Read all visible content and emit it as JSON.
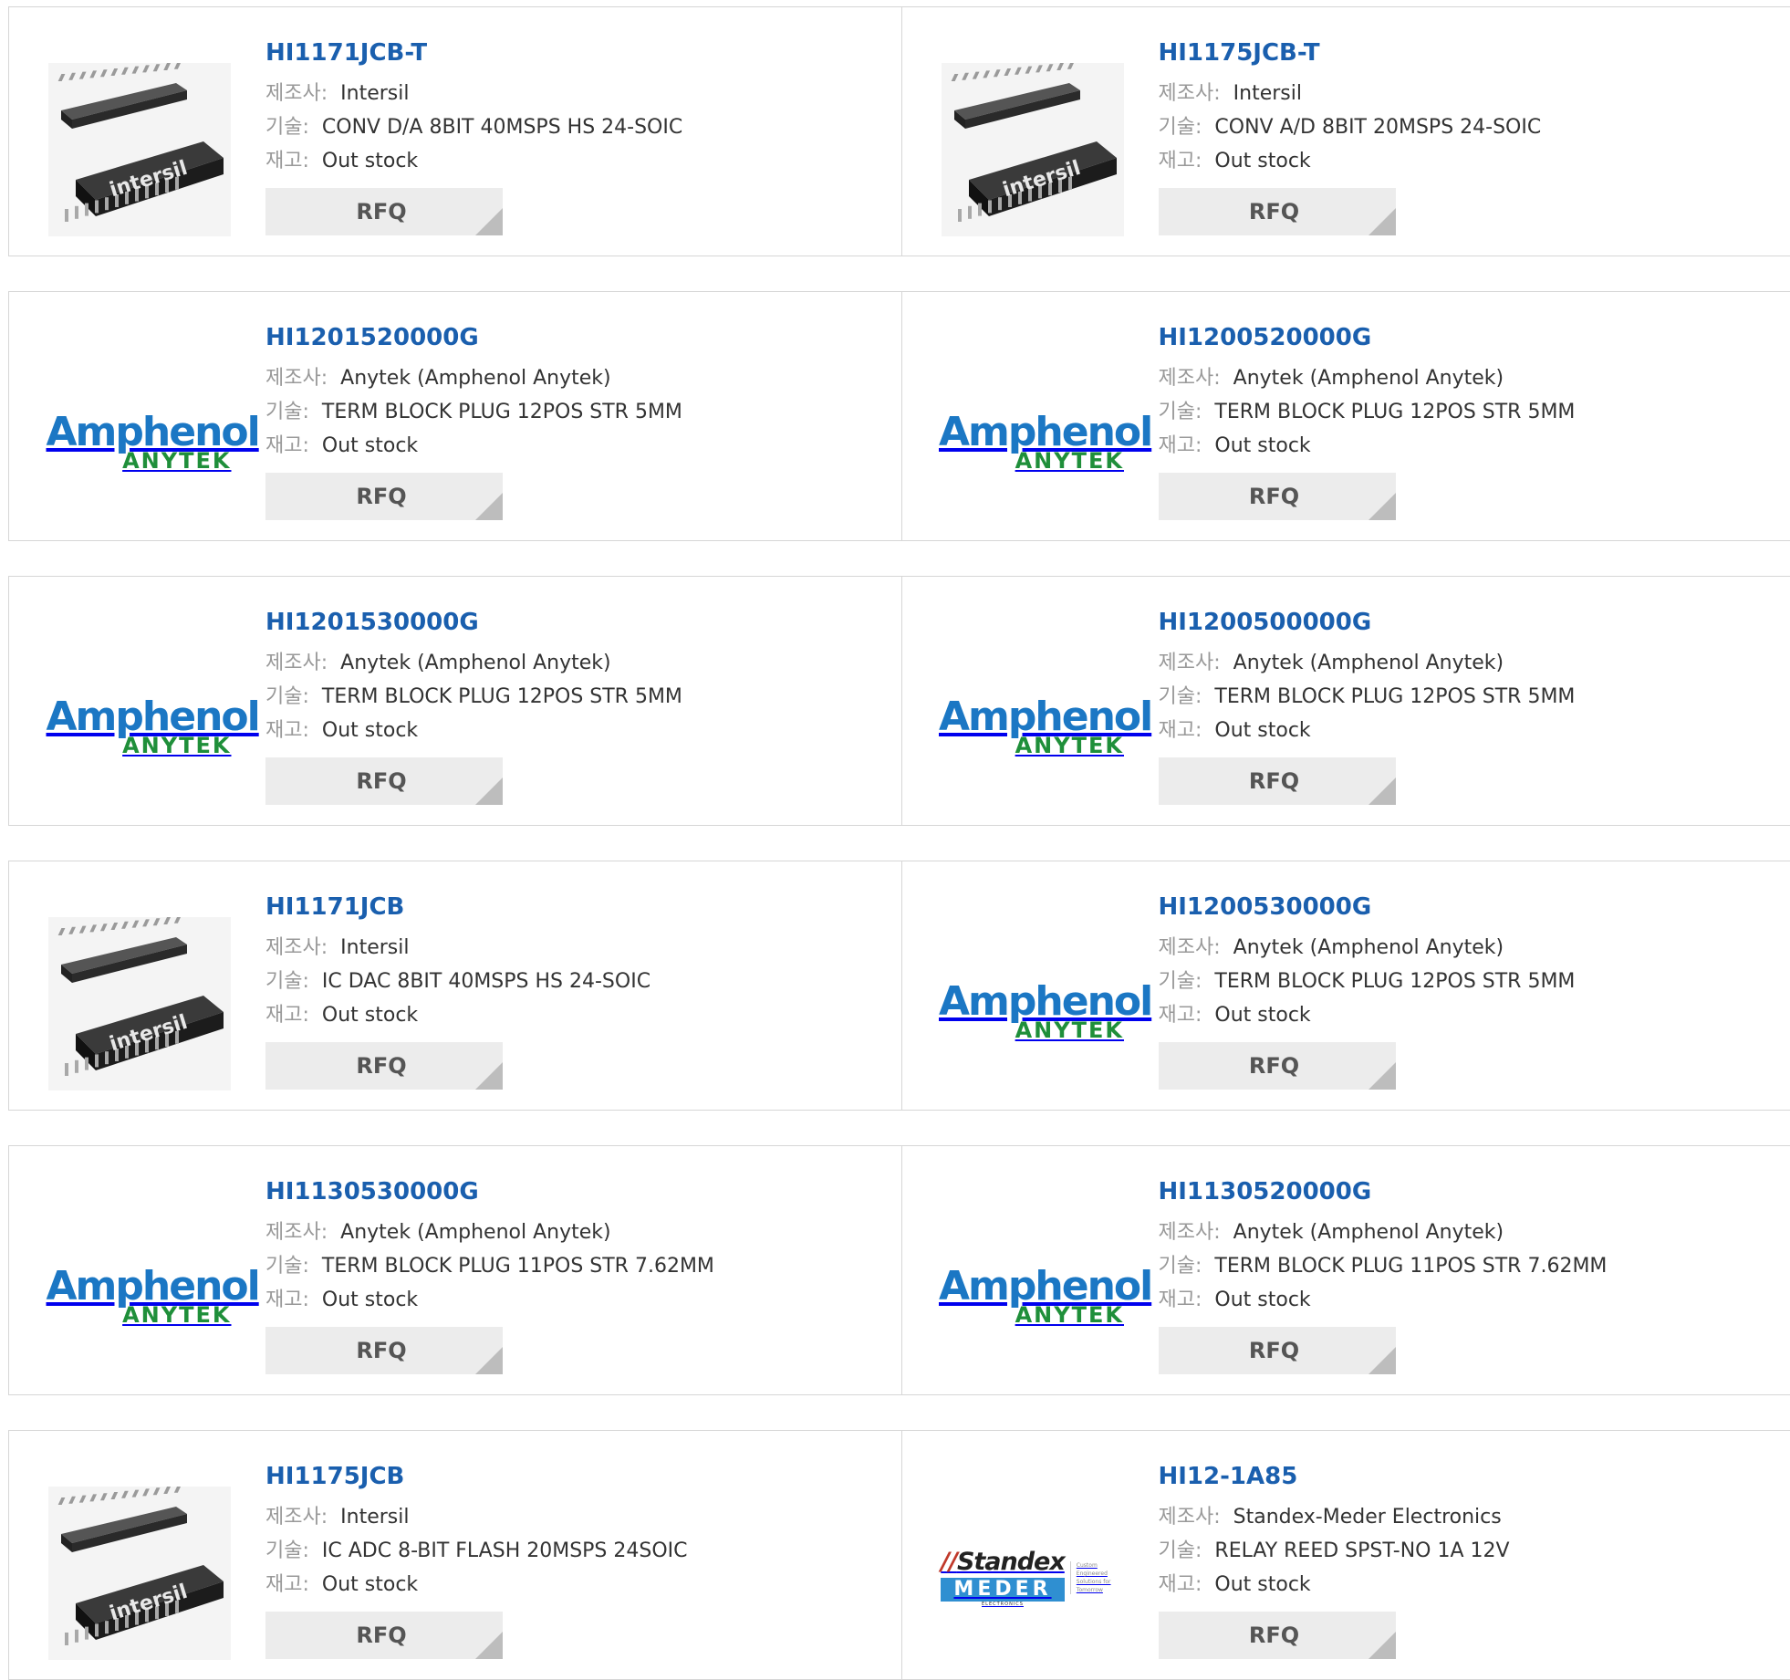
{
  "labels": {
    "manufacturer": "제조사",
    "description": "기술",
    "stock": "재고",
    "separator": ":",
    "rfq": "RFQ"
  },
  "logos": {
    "intersil_chip": "intersil",
    "amphenol_top": "Amphenol",
    "amphenol_bottom": "ANYTEK",
    "standex_top": "Standex",
    "standex_bottom": "MEDER",
    "standex_small": "ELECTRONICS",
    "standex_tagline": "Custom Engineered Solutions for Tomorrow"
  },
  "colors": {
    "part_link": "#1a5fae",
    "amphenol_blue": "#1b77c4",
    "anytek_green": "#1f8f3a",
    "meder_blue": "#2f8fd1",
    "button_bg": "#ececec"
  },
  "products": [
    {
      "part": "HI1171JCB-T",
      "manufacturer": "Intersil",
      "description": "CONV D/A 8BIT 40MSPS HS 24-SOIC",
      "stock": "Out stock",
      "logo": "intersil-chip"
    },
    {
      "part": "HI1175JCB-T",
      "manufacturer": "Intersil",
      "description": "CONV A/D 8BIT 20MSPS 24-SOIC",
      "stock": "Out stock",
      "logo": "intersil-chip"
    },
    {
      "part": "HI1201520000G",
      "manufacturer": "Anytek (Amphenol Anytek)",
      "description": "TERM BLOCK PLUG 12POS STR 5MM",
      "stock": "Out stock",
      "logo": "amphenol-anytek"
    },
    {
      "part": "HI1200520000G",
      "manufacturer": "Anytek (Amphenol Anytek)",
      "description": "TERM BLOCK PLUG 12POS STR 5MM",
      "stock": "Out stock",
      "logo": "amphenol-anytek"
    },
    {
      "part": "HI1201530000G",
      "manufacturer": "Anytek (Amphenol Anytek)",
      "description": "TERM BLOCK PLUG 12POS STR 5MM",
      "stock": "Out stock",
      "logo": "amphenol-anytek"
    },
    {
      "part": "HI1200500000G",
      "manufacturer": "Anytek (Amphenol Anytek)",
      "description": "TERM BLOCK PLUG 12POS STR 5MM",
      "stock": "Out stock",
      "logo": "amphenol-anytek"
    },
    {
      "part": "HI1171JCB",
      "manufacturer": "Intersil",
      "description": "IC DAC 8BIT 40MSPS HS 24-SOIC",
      "stock": "Out stock",
      "logo": "intersil-chip"
    },
    {
      "part": "HI1200530000G",
      "manufacturer": "Anytek (Amphenol Anytek)",
      "description": "TERM BLOCK PLUG 12POS STR 5MM",
      "stock": "Out stock",
      "logo": "amphenol-anytek"
    },
    {
      "part": "HI1130530000G",
      "manufacturer": "Anytek (Amphenol Anytek)",
      "description": "TERM BLOCK PLUG 11POS STR 7.62MM",
      "stock": "Out stock",
      "logo": "amphenol-anytek"
    },
    {
      "part": "HI1130520000G",
      "manufacturer": "Anytek (Amphenol Anytek)",
      "description": "TERM BLOCK PLUG 11POS STR 7.62MM",
      "stock": "Out stock",
      "logo": "amphenol-anytek"
    },
    {
      "part": "HI1175JCB",
      "manufacturer": "Intersil",
      "description": "IC ADC 8-BIT FLASH 20MSPS 24SOIC",
      "stock": "Out stock",
      "logo": "intersil-chip"
    },
    {
      "part": "HI12-1A85",
      "manufacturer": "Standex-Meder Electronics",
      "description": "RELAY REED SPST-NO 1A 12V",
      "stock": "Out stock",
      "logo": "standex-meder"
    }
  ]
}
